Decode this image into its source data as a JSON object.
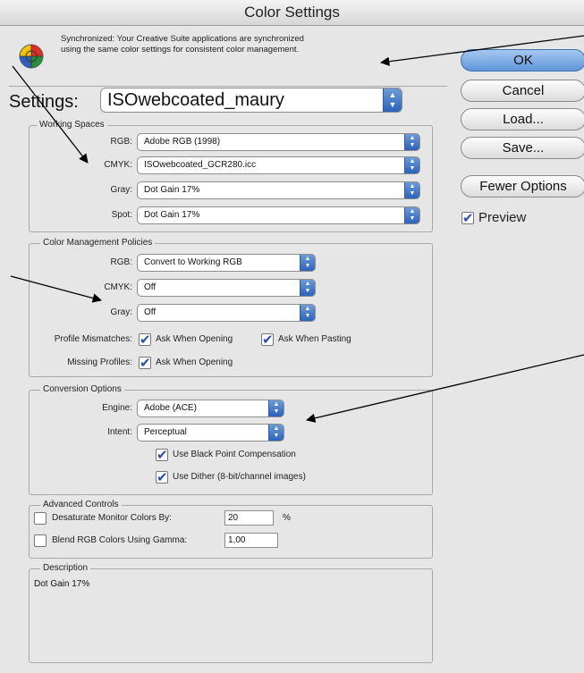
{
  "window": {
    "title": "Color Settings"
  },
  "sync": {
    "line1": "Synchronized: Your Creative Suite applications are synchronized",
    "line2": "using the same color settings for consistent color management."
  },
  "settings": {
    "label": "Settings:",
    "value": "ISOwebcoated_maury"
  },
  "working_spaces": {
    "title": "Working Spaces",
    "rows": [
      {
        "label": "RGB:",
        "value": "Adobe RGB (1998)"
      },
      {
        "label": "CMYK:",
        "value": "ISOwebcoated_GCR280.icc"
      },
      {
        "label": "Gray:",
        "value": "Dot Gain 17%"
      },
      {
        "label": "Spot:",
        "value": "Dot Gain 17%"
      }
    ]
  },
  "policies": {
    "title": "Color Management Policies",
    "rows": [
      {
        "label": "RGB:",
        "value": "Convert to Working RGB"
      },
      {
        "label": "CMYK:",
        "value": "Off"
      },
      {
        "label": "Gray:",
        "value": "Off"
      }
    ],
    "mismatch_label": "Profile Mismatches:",
    "ask_opening": "Ask When Opening",
    "ask_pasting": "Ask When Pasting",
    "missing_label": "Missing Profiles:",
    "missing_ask_opening": "Ask When Opening"
  },
  "conversion": {
    "title": "Conversion Options",
    "engine_label": "Engine:",
    "engine_value": "Adobe (ACE)",
    "intent_label": "Intent:",
    "intent_value": "Perceptual",
    "bpc_label": "Use Black Point Compensation",
    "dither_label": "Use Dither (8-bit/channel images)"
  },
  "advanced": {
    "title": "Advanced Controls",
    "desaturate_label": "Desaturate Monitor Colors By:",
    "desaturate_value": "20",
    "desaturate_unit": "%",
    "blend_label": "Blend RGB Colors Using Gamma:",
    "blend_value": "1,00"
  },
  "description": {
    "title": "Description",
    "text": "Dot Gain 17%"
  },
  "buttons": {
    "ok": "OK",
    "cancel": "Cancel",
    "load": "Load...",
    "save": "Save...",
    "fewer": "Fewer Options",
    "preview": "Preview"
  },
  "colors": {
    "accent": "#5f95db",
    "check": "#2a4fa8",
    "dialog_bg": "#e6e6e6"
  }
}
